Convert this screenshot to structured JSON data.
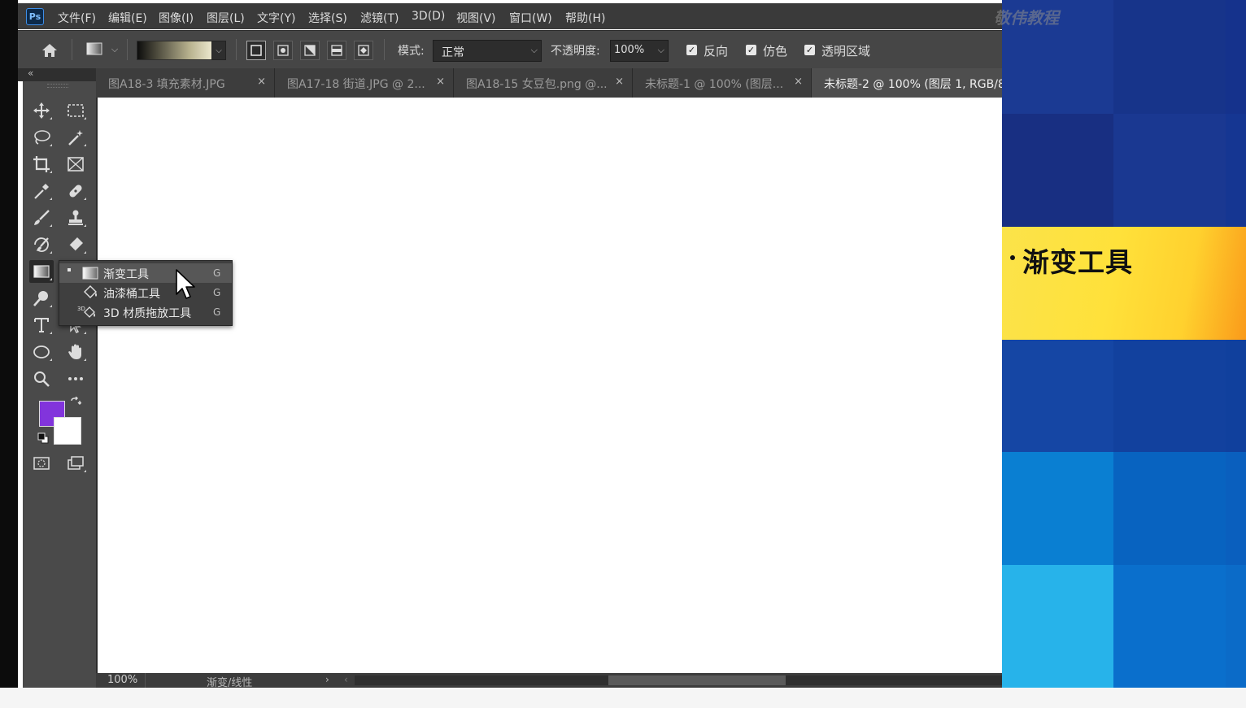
{
  "app": {
    "logo": "Ps"
  },
  "menubar": {
    "items": [
      "文件(F)",
      "编辑(E)",
      "图像(I)",
      "图层(L)",
      "文字(Y)",
      "选择(S)",
      "滤镜(T)",
      "3D(D)",
      "视图(V)",
      "窗口(W)",
      "帮助(H)"
    ]
  },
  "watermark": "敬伟教程",
  "options": {
    "mode_label": "模式:",
    "mode_value": "正常",
    "opacity_label": "不透明度:",
    "opacity_value": "100%",
    "reverse_label": "反向",
    "dither_label": "仿色",
    "transparency_label": "透明区域",
    "reverse_checked": true,
    "dither_checked": true,
    "transparency_checked": true
  },
  "tabs": [
    {
      "label": "图A18-3 填充素材.JPG",
      "close": "×"
    },
    {
      "label": "图A17-18 街道.JPG @ 2...",
      "close": "×"
    },
    {
      "label": "图A18-15 女豆包.png @...",
      "close": "×"
    },
    {
      "label": "未标题-1 @ 100% (图层...",
      "close": "×"
    },
    {
      "label": "未标题-2 @ 100% (图层 1, RGB/8",
      "close": ""
    }
  ],
  "toolbar": {
    "collapse": "«",
    "fg_color": "#8234dc",
    "bg_color": "#ffffff"
  },
  "flyout": {
    "items": [
      {
        "label": "渐变工具",
        "key": "G",
        "icon": "gradient-icon"
      },
      {
        "label": "油漆桶工具",
        "key": "G",
        "icon": "paint-bucket-icon"
      },
      {
        "label": "3D 材质拖放工具",
        "key": "G",
        "icon": "3d-material-drop-icon"
      }
    ]
  },
  "status": {
    "zoom": "100%",
    "tool": "渐变/线性",
    "arrow": "›",
    "scroll_left": "‹"
  },
  "slide": {
    "title": "渐变工具"
  }
}
